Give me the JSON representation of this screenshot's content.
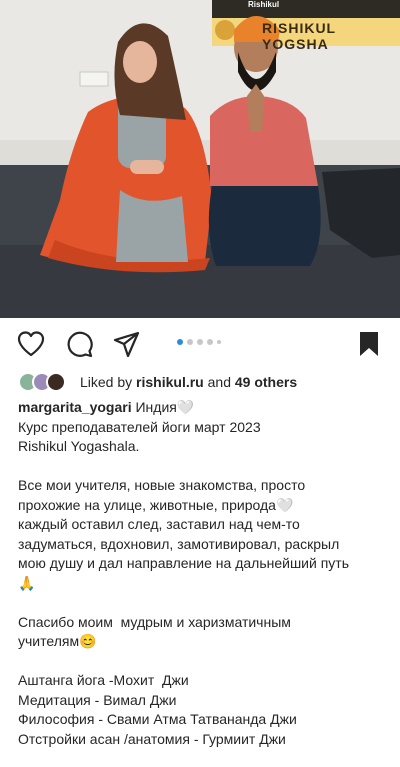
{
  "photo": {
    "banner_text": "RISHIKUL YOGSHA",
    "banner_logo_text": "Rishikul"
  },
  "actions": {
    "like_icon": "heart-outline-icon",
    "comment_icon": "comment-icon",
    "share_icon": "paper-plane-icon",
    "save_icon": "bookmark-filled-icon",
    "carousel_count": 5,
    "carousel_active_index": 0
  },
  "likes": {
    "prefix": "Liked by ",
    "user": "rishikul.ru",
    "middle": " and ",
    "others": "49 others"
  },
  "caption": {
    "username": "margarita_yogari",
    "first_line_rest": " Индия🤍",
    "lines": [
      "Курс преподавателей йоги март 2023",
      "Rishikul Yogashala.",
      "",
      "Все мои учителя, новые знакомства, просто",
      "прохожие на улице, животные, природа🤍",
      "каждый оставил след, заставил над чем-то",
      "задуматься, вдохновил, замотивировал, раскрыл",
      "мою душу и дал направление на дальнейший путь",
      "🙏",
      "",
      "Спасибо моим  мудрым и харизматичным",
      "учителям😊",
      "",
      "Аштанга йога -Мохит  Джи",
      "Медитация - Вимал Джи",
      "Философия - Свами Атма Татвананда Джи",
      "Отстройки асан /анатомия - Гурмиит Джи"
    ]
  },
  "colors": {
    "accent_blue": "#2a8cdf",
    "text": "#262626"
  }
}
